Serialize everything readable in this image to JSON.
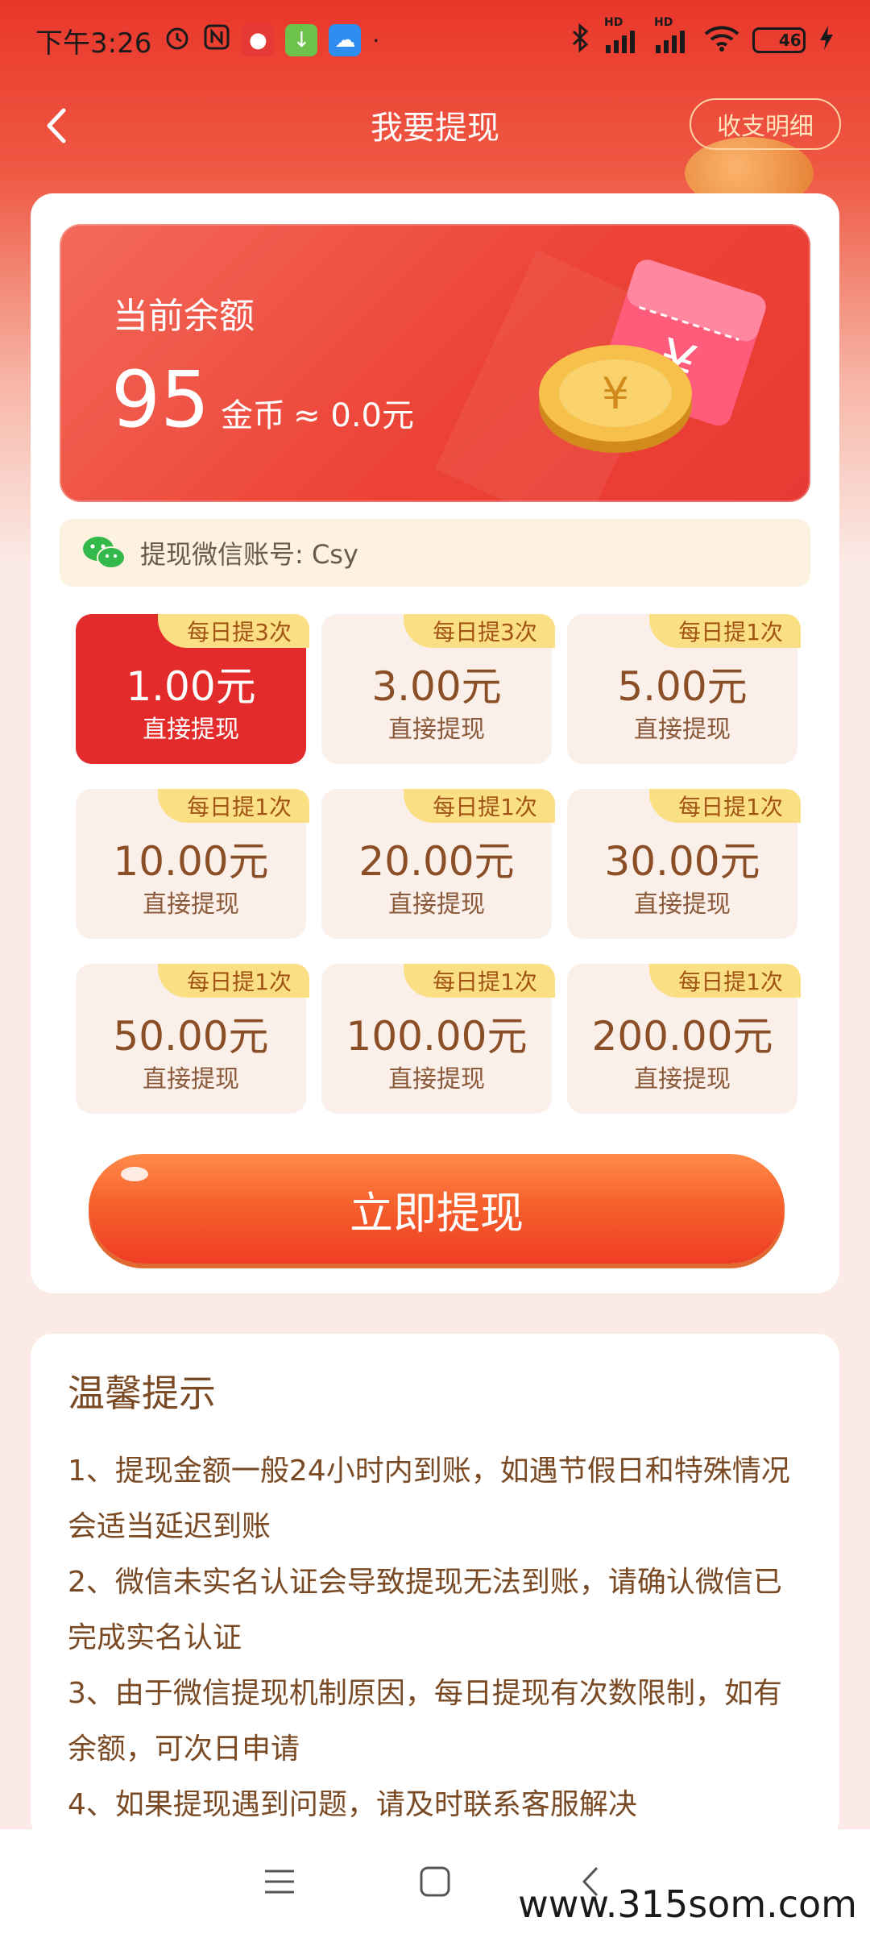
{
  "status_bar": {
    "time": "下午3:26",
    "battery": "46",
    "hd1": "HD",
    "hd2": "HD"
  },
  "nav": {
    "title": "我要提现",
    "history_label": "收支明细"
  },
  "balance": {
    "label": "当前余额",
    "amount": "95",
    "unit": "金币",
    "approx": "≈ 0.0元"
  },
  "wechat": {
    "account_text": "提现微信账号: Csy"
  },
  "options": [
    {
      "badge": "每日提3次",
      "amount": "1.00元",
      "sub": "直接提现",
      "selected": true
    },
    {
      "badge": "每日提3次",
      "amount": "3.00元",
      "sub": "直接提现",
      "selected": false
    },
    {
      "badge": "每日提1次",
      "amount": "5.00元",
      "sub": "直接提现",
      "selected": false
    },
    {
      "badge": "每日提1次",
      "amount": "10.00元",
      "sub": "直接提现",
      "selected": false
    },
    {
      "badge": "每日提1次",
      "amount": "20.00元",
      "sub": "直接提现",
      "selected": false
    },
    {
      "badge": "每日提1次",
      "amount": "30.00元",
      "sub": "直接提现",
      "selected": false
    },
    {
      "badge": "每日提1次",
      "amount": "50.00元",
      "sub": "直接提现",
      "selected": false
    },
    {
      "badge": "每日提1次",
      "amount": "100.00元",
      "sub": "直接提现",
      "selected": false
    },
    {
      "badge": "每日提1次",
      "amount": "200.00元",
      "sub": "直接提现",
      "selected": false
    }
  ],
  "withdraw_button": "立即提现",
  "tips": {
    "title": "温馨提示",
    "items": [
      "1、提现金额一般24小时内到账，如遇节假日和特殊情况会适当延迟到账",
      "2、微信未实名认证会导致提现无法到账，请确认微信已完成实名认证",
      "3、由于微信提现机制原因，每日提现有次数限制，如有余额，可次日申请",
      "4、如果提现遇到问题，请及时联系客服解决"
    ]
  },
  "watermark": "www.315som.com",
  "colors": {
    "accent": "#e83a34",
    "selected_option": "#e32b2b",
    "badge": "#fbdf84"
  }
}
